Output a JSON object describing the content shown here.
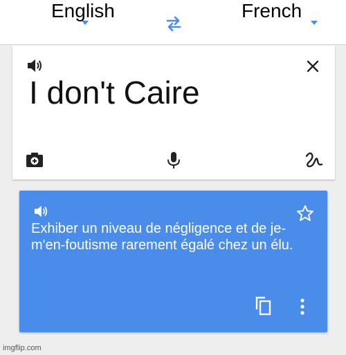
{
  "header": {
    "source_language": "English",
    "target_language": "French",
    "swap_icon": "swap-arrows-icon"
  },
  "input": {
    "text": "I don't Caire",
    "icons": [
      "speaker-icon",
      "close-icon",
      "camera-icon",
      "mic-icon",
      "handwriting-icon"
    ]
  },
  "output": {
    "text": "Exhiber un niveau de négligence et de je-m'en-foutisme rarement égalé chez un élu.",
    "icons": [
      "speaker-icon",
      "star-icon",
      "copy-icon",
      "more-vert-icon"
    ],
    "background_color": "#4a8cea"
  },
  "colors": {
    "accent": "#4a8cea"
  },
  "watermark": "imgflip.com"
}
